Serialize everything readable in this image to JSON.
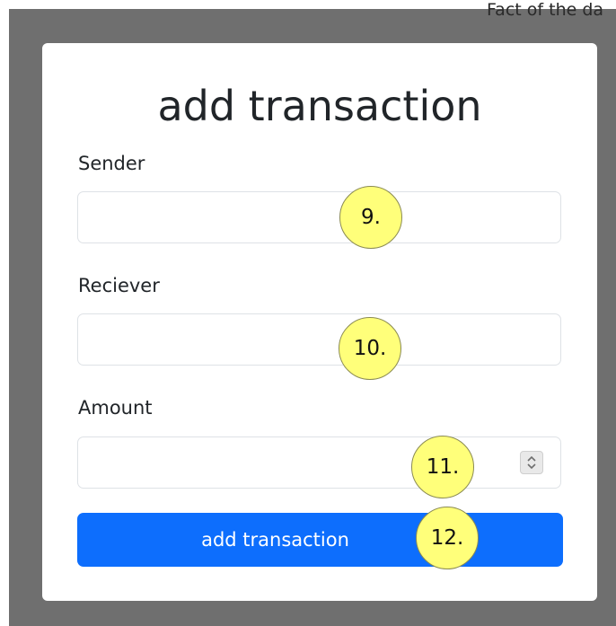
{
  "background": {
    "partial_text": "Fact of the da"
  },
  "modal": {
    "title": "add transaction",
    "fields": [
      {
        "label": "Sender",
        "value": "",
        "placeholder": ""
      },
      {
        "label": "Reciever",
        "value": "",
        "placeholder": ""
      },
      {
        "label": "Amount",
        "value": "",
        "placeholder": ""
      }
    ],
    "submit_label": "add transaction"
  },
  "markers": [
    "9.",
    "10.",
    "11.",
    "12."
  ],
  "colors": {
    "primary": "#0d6efd",
    "overlay": "#6f6f6f",
    "marker": "#ffff7a",
    "input_border": "#dee2e6"
  },
  "icons": {
    "amount_stepper": "spinner-arrows-icon"
  }
}
